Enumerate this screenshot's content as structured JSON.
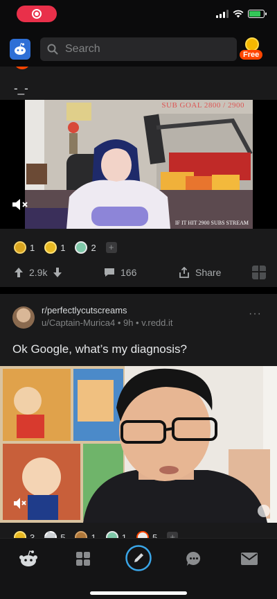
{
  "status_bar": {
    "recording_indicator": "screen-record",
    "battery_level": 0.8,
    "icons": [
      "signal-icon",
      "wifi-icon",
      "battery-icon"
    ]
  },
  "header": {
    "search_placeholder": "Search",
    "coins_badge": "Free"
  },
  "post1": {
    "title": "-_-",
    "video": {
      "overlay_top": "SUB GOAL 2800 / 2900",
      "overlay_bottom": "IF IT HIT 2900 SUBS STREAM",
      "muted": true
    },
    "awards": [
      {
        "icon": "silver-award-icon",
        "color": "#d9a520",
        "count": "1"
      },
      {
        "icon": "gold-award-icon",
        "color": "#e8b923",
        "count": "1"
      },
      {
        "icon": "wholesome-award-icon",
        "color": "#7fc8a9",
        "count": "2"
      }
    ],
    "score": "2.9k",
    "comments": "166",
    "share_label": "Share"
  },
  "post2": {
    "subreddit": "r/perfectlycutscreams",
    "meta": "u/Captain-Murica4 • 9h • v.redd.it",
    "title": "Ok Google, what’s my diagnosis?",
    "awards": [
      {
        "icon": "gold-award-icon",
        "color": "#e8b923",
        "count": "3"
      },
      {
        "icon": "burst-award-icon",
        "color": "#cfd3d6",
        "count": "5"
      },
      {
        "icon": "bear-award-icon",
        "color": "#b0783a",
        "count": "1"
      },
      {
        "icon": "wholesome-award-icon",
        "color": "#7fc8a9",
        "count": "1"
      },
      {
        "icon": "snoo-award-icon",
        "color": "#e9eaea",
        "count": "5"
      }
    ]
  },
  "tabbar": {
    "tabs": [
      "home",
      "communities",
      "create",
      "chat",
      "inbox"
    ],
    "active": "home",
    "accent": "#3aa6e8"
  }
}
